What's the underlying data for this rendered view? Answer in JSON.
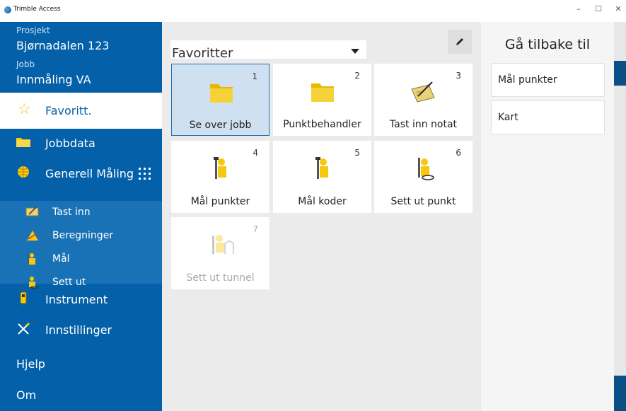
{
  "window": {
    "title": "Trimble Access",
    "minimize": "–",
    "maximize": "☐",
    "close": "✕"
  },
  "sidebar": {
    "project_label": "Prosjekt",
    "project_name": "Bjørnadalen 123",
    "job_label": "Jobb",
    "job_name": "Innmåling VA",
    "favorites": "Favoritt.",
    "items": [
      {
        "label": "Jobbdata",
        "icon": "folder-icon"
      },
      {
        "label": "Generell Måling",
        "icon": "globe-icon"
      }
    ],
    "sub_items": [
      {
        "label": "Tast inn",
        "icon": "keypad-icon"
      },
      {
        "label": "Beregninger",
        "icon": "calculator-icon"
      },
      {
        "label": "Mål",
        "icon": "surveyor-icon"
      },
      {
        "label": "Sett ut",
        "icon": "stakeout-icon"
      }
    ],
    "bottom_items": [
      {
        "label": "Instrument",
        "icon": "instrument-icon"
      },
      {
        "label": "Innstillinger",
        "icon": "tools-icon"
      },
      {
        "label": "Hjelp"
      },
      {
        "label": "Om"
      }
    ]
  },
  "main": {
    "dropdown_value": "Favoritter",
    "tiles": [
      {
        "num": "1",
        "label": "Se over jobb",
        "icon": "folder-icon",
        "selected": true
      },
      {
        "num": "2",
        "label": "Punktbehandler",
        "icon": "folder-icon"
      },
      {
        "num": "3",
        "label": "Tast inn notat",
        "icon": "note-icon"
      },
      {
        "num": "4",
        "label": "Mål punkter",
        "icon": "surveyor-icon"
      },
      {
        "num": "5",
        "label": "Mål koder",
        "icon": "surveyor-icon"
      },
      {
        "num": "6",
        "label": "Sett ut punkt",
        "icon": "stakeout-icon"
      },
      {
        "num": "7",
        "label": "Sett ut tunnel",
        "icon": "tunnel-icon",
        "disabled": true
      }
    ]
  },
  "right_panel": {
    "heading": "Gå tilbake til",
    "items": [
      "Mål punkter",
      "Kart"
    ]
  },
  "colors": {
    "sidebar_blue": "#0460a8",
    "sub_blue": "#1a72b6",
    "selected_tile": "#cfe0f0",
    "icon_yellow": "#f6c90e"
  }
}
